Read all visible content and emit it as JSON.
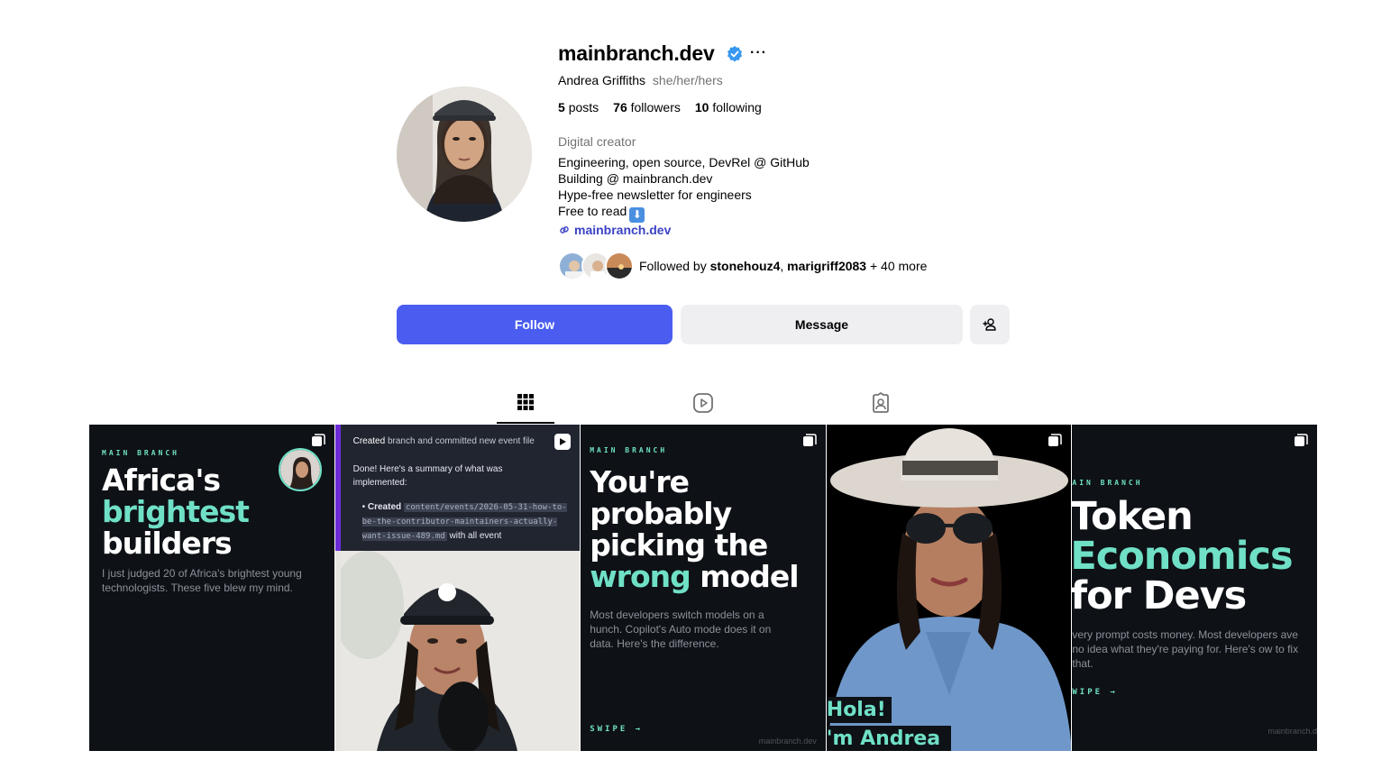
{
  "profile": {
    "username": "mainbranch.dev",
    "name": "Andrea Griffiths",
    "pronouns": "she/her/hers",
    "more_label": "···",
    "stats": {
      "posts_count": "5",
      "posts_label": "posts",
      "followers_count": "76",
      "followers_label": "followers",
      "following_count": "10",
      "following_label": "following"
    },
    "category": "Digital creator",
    "bio": [
      "Engineering, open source, DevRel @ GitHub",
      "Building @ mainbranch.dev",
      "Hype-free newsletter for engineers",
      "Free to read"
    ],
    "bio_emoji": "⬇",
    "link": "mainbranch.dev",
    "followed_by": {
      "prefix": "Followed by",
      "user1": "stonehouz4",
      "separator": ",",
      "user2": "marigriff2083",
      "suffix": "+ 40 more"
    }
  },
  "actions": {
    "follow": "Follow",
    "message": "Message"
  },
  "tabs": {
    "active": "posts",
    "icons": [
      "grid-icon",
      "reels-icon",
      "tagged-icon"
    ]
  },
  "posts": [
    {
      "brand": "MAIN BRANCH",
      "title_1": "Africa's",
      "title_2": "brightest",
      "title_3": "builders",
      "desc": "I just judged 20 of Africa's brightest young technologists. These five blew my mind."
    },
    {
      "header_prefix": "Created",
      "header_rest": "branch and committed new event file",
      "summary": "Done! Here's a summary of what was implemented:",
      "bullet_label": "Created",
      "code": "content/events/2026-05-31-how-to-be-the-contributor-maintainers-actually-want-issue-489.md",
      "bullet_rest": "with all event"
    },
    {
      "brand": "MAIN BRANCH",
      "title_1": "You're",
      "title_2": "probably",
      "title_3": "picking the",
      "title_4a": "wrong",
      "title_4b": "model",
      "desc": "Most developers switch models on a hunch. Copilot's Auto mode does it on data. Here's the difference.",
      "swipe": "SWIPE →",
      "handle": "mainbranch.dev"
    },
    {
      "caption_1": "Hola!",
      "caption_2": "'m Andrea"
    },
    {
      "brand": "AIN BRANCH",
      "title_1": "Token",
      "title_2": "Economics",
      "title_3": "for Devs",
      "desc": "very prompt costs money. Most developers ave no idea what they're paying for. Here's ow to fix that.",
      "swipe": "WIPE →",
      "handle": "mainbranch.d"
    }
  ],
  "colors": {
    "follow_button": "#4a5df0",
    "link": "#3b42c4",
    "verified": "#3897f0",
    "mint_accent": "#6fe0c6",
    "post_bg": "#0e1116"
  }
}
